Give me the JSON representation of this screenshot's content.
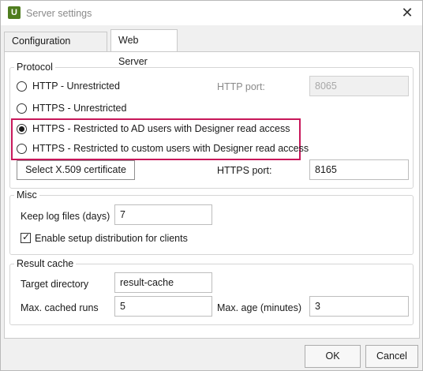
{
  "window": {
    "title": "Server settings",
    "app_icon_letter": "U",
    "close_glyph": "✕"
  },
  "tabs": [
    {
      "label": "Configuration Server",
      "active": false
    },
    {
      "label": "Web Server",
      "active": true
    }
  ],
  "protocol": {
    "legend": "Protocol",
    "options": [
      {
        "label": "HTTP - Unrestricted",
        "checked": false
      },
      {
        "label": "HTTPS - Unrestricted",
        "checked": false
      },
      {
        "label": "HTTPS - Restricted to AD users with Designer read access",
        "checked": true
      },
      {
        "label": "HTTPS - Restricted to custom users with Designer read access",
        "checked": false
      }
    ],
    "http_port_label": "HTTP port:",
    "http_port_value": "8065",
    "https_port_label": "HTTPS port:",
    "https_port_value": "8165",
    "certificate_button": "Select X.509 certificate",
    "highlight_color": "#c8175a"
  },
  "misc": {
    "legend": "Misc",
    "keep_log_label": "Keep log files (days)",
    "keep_log_value": "7",
    "enable_distribution_label": "Enable setup distribution for clients",
    "enable_distribution_checked": true
  },
  "result_cache": {
    "legend": "Result cache",
    "target_dir_label": "Target directory",
    "target_dir_value": "result-cache",
    "max_runs_label": "Max. cached runs",
    "max_runs_value": "5",
    "max_age_label": "Max. age (minutes)",
    "max_age_value": "3"
  },
  "footer": {
    "ok_label": "OK",
    "cancel_label": "Cancel"
  }
}
